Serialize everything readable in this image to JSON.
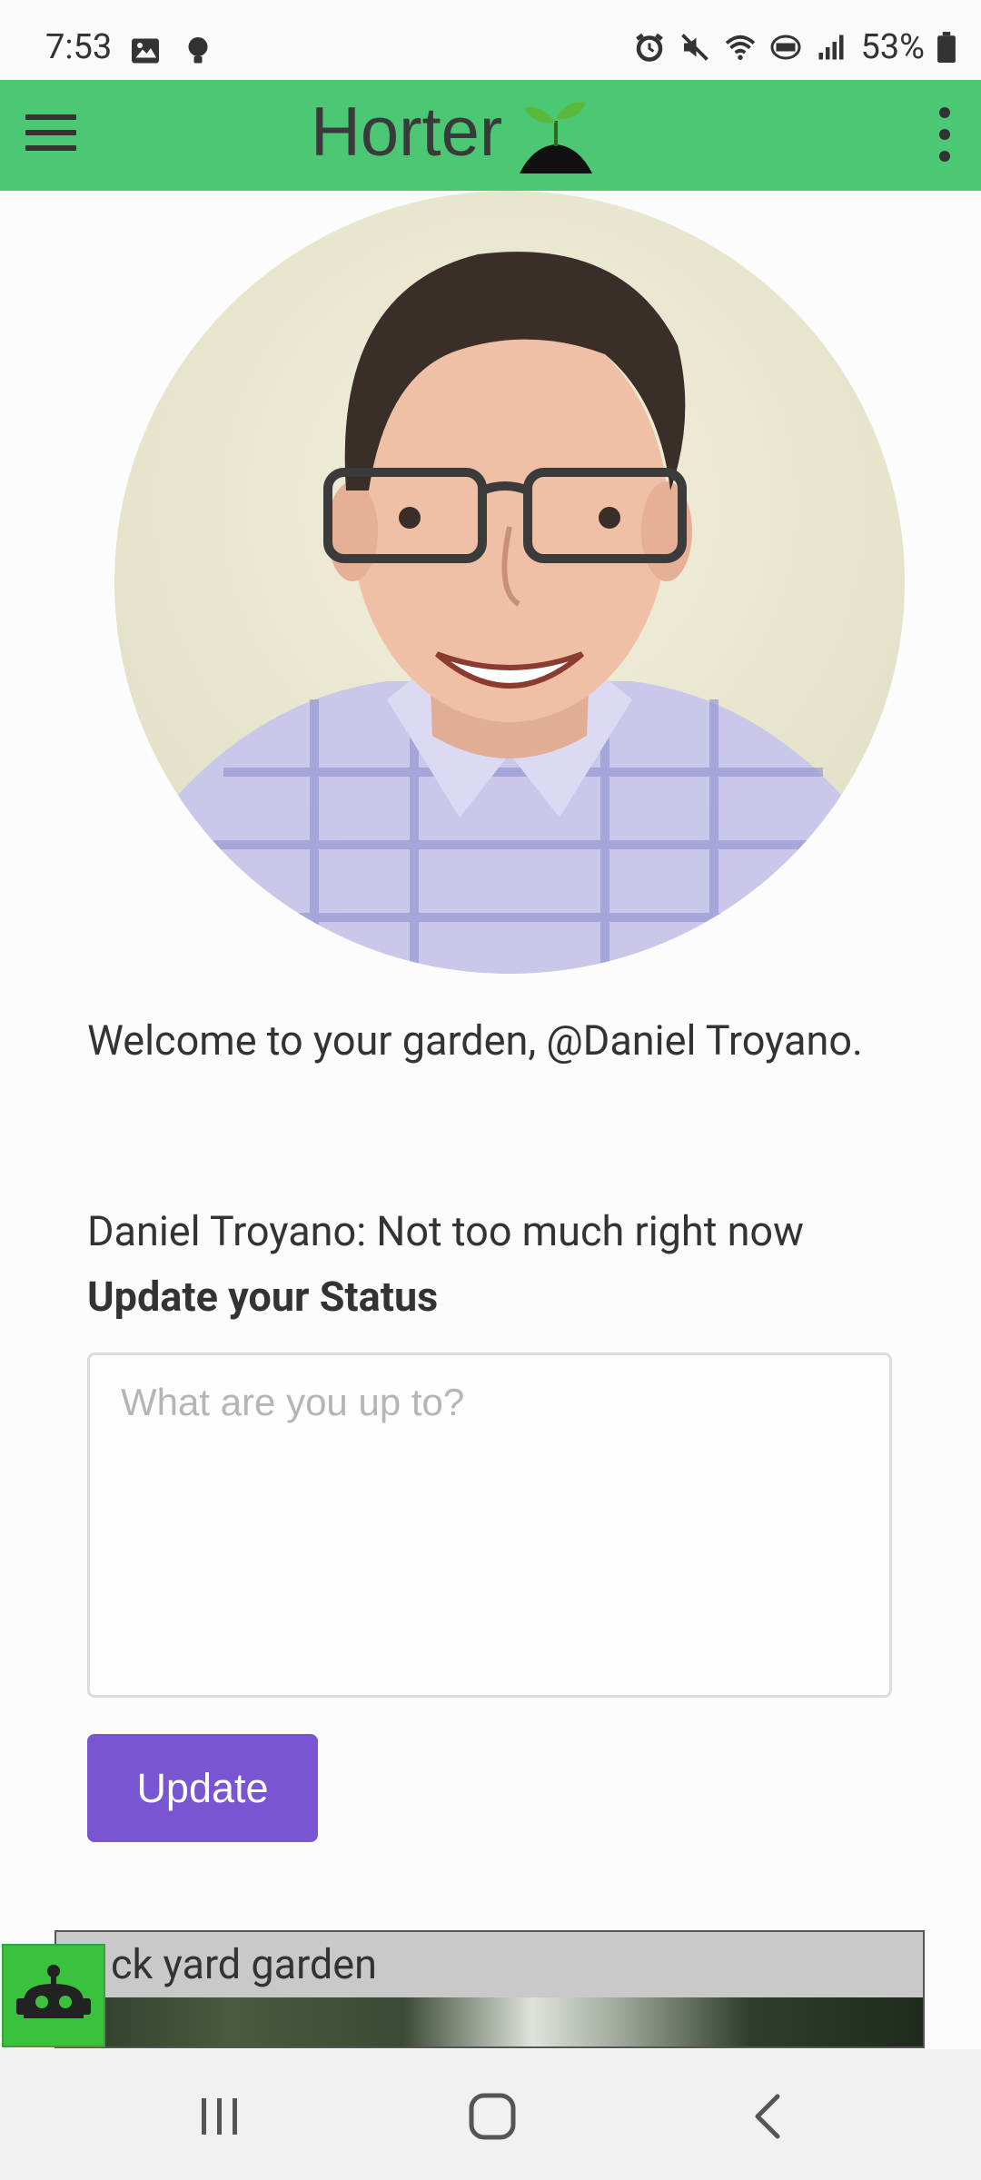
{
  "status_bar": {
    "time": "7:53",
    "battery": "53%",
    "icons": [
      "gallery-icon",
      "bulb-icon",
      "alarm-icon",
      "mute-icon",
      "wifi-icon",
      "volte-icon",
      "signal-icon",
      "battery-icon"
    ]
  },
  "app_bar": {
    "title": "Horter",
    "logo": "sprout-logo"
  },
  "profile": {
    "welcome": "Welcome to your garden, @Daniel Troyano.",
    "status_line": "Daniel Troyano: Not too much right now",
    "update_heading": "Update your Status",
    "status_placeholder": "What are you up to?",
    "status_value": "",
    "update_button": "Update"
  },
  "garden_card": {
    "title": "ck yard garden"
  },
  "colors": {
    "app_bar": "#4cc774",
    "update_button": "#7a55d2",
    "bot_button": "#3ac23e"
  }
}
